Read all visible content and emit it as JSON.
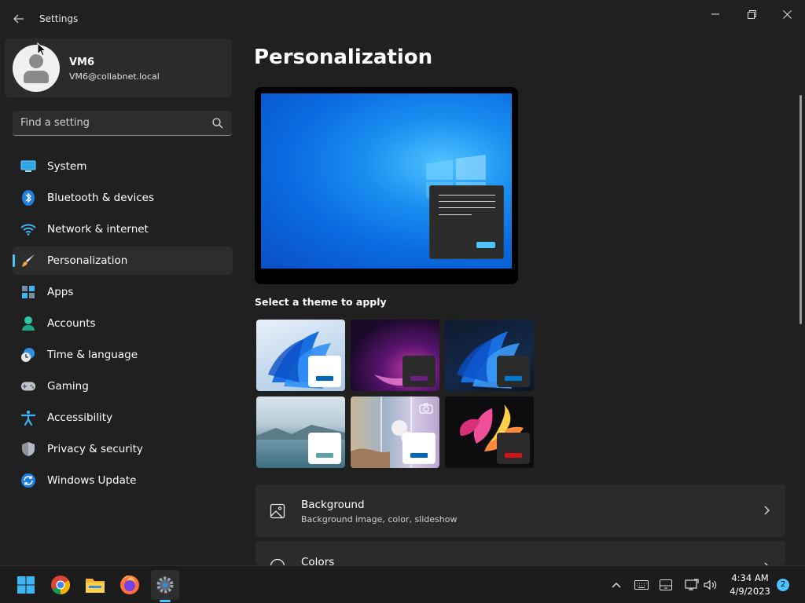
{
  "window": {
    "app_title": "Settings"
  },
  "user": {
    "name": "VM6",
    "email": "VM6@collabnet.local"
  },
  "search": {
    "placeholder": "Find a setting"
  },
  "sidebar": {
    "items": [
      {
        "label": "System",
        "icon": "system-icon"
      },
      {
        "label": "Bluetooth & devices",
        "icon": "bluetooth-icon"
      },
      {
        "label": "Network & internet",
        "icon": "wifi-icon"
      },
      {
        "label": "Personalization",
        "icon": "brush-icon",
        "active": true
      },
      {
        "label": "Apps",
        "icon": "apps-icon"
      },
      {
        "label": "Accounts",
        "icon": "accounts-icon"
      },
      {
        "label": "Time & language",
        "icon": "globe-clock-icon"
      },
      {
        "label": "Gaming",
        "icon": "gamepad-icon"
      },
      {
        "label": "Accessibility",
        "icon": "accessibility-icon"
      },
      {
        "label": "Privacy & security",
        "icon": "shield-icon"
      },
      {
        "label": "Windows Update",
        "icon": "update-icon"
      }
    ]
  },
  "main": {
    "page_title": "Personalization",
    "themes_label": "Select a theme to apply",
    "themes": [
      {
        "name": "windows-light",
        "accent": "#0067c0",
        "swatch": "#ffffff"
      },
      {
        "name": "glow",
        "accent": "#6b1d86",
        "swatch": "#2b2b2b"
      },
      {
        "name": "windows-dark",
        "accent": "#0078d4",
        "swatch": "#2b2b2b"
      },
      {
        "name": "captured-motion",
        "accent": "#5aa3a8",
        "swatch": "#ffffff"
      },
      {
        "name": "sunrise",
        "accent": "#0067c0",
        "swatch": "#ffffff"
      },
      {
        "name": "flow",
        "accent": "#d0121b",
        "swatch": "#2b2b2b"
      }
    ],
    "cards": [
      {
        "title": "Background",
        "subtitle": "Background image, color, slideshow",
        "icon": "image-icon"
      },
      {
        "title": "Colors",
        "icon": "palette-icon"
      }
    ]
  },
  "taskbar": {
    "time": "4:34 AM",
    "date": "4/9/2023",
    "notification_count": "2"
  },
  "colors": {
    "accent": "#4cc2ff",
    "background": "#202020",
    "card": "#2b2b2b"
  }
}
